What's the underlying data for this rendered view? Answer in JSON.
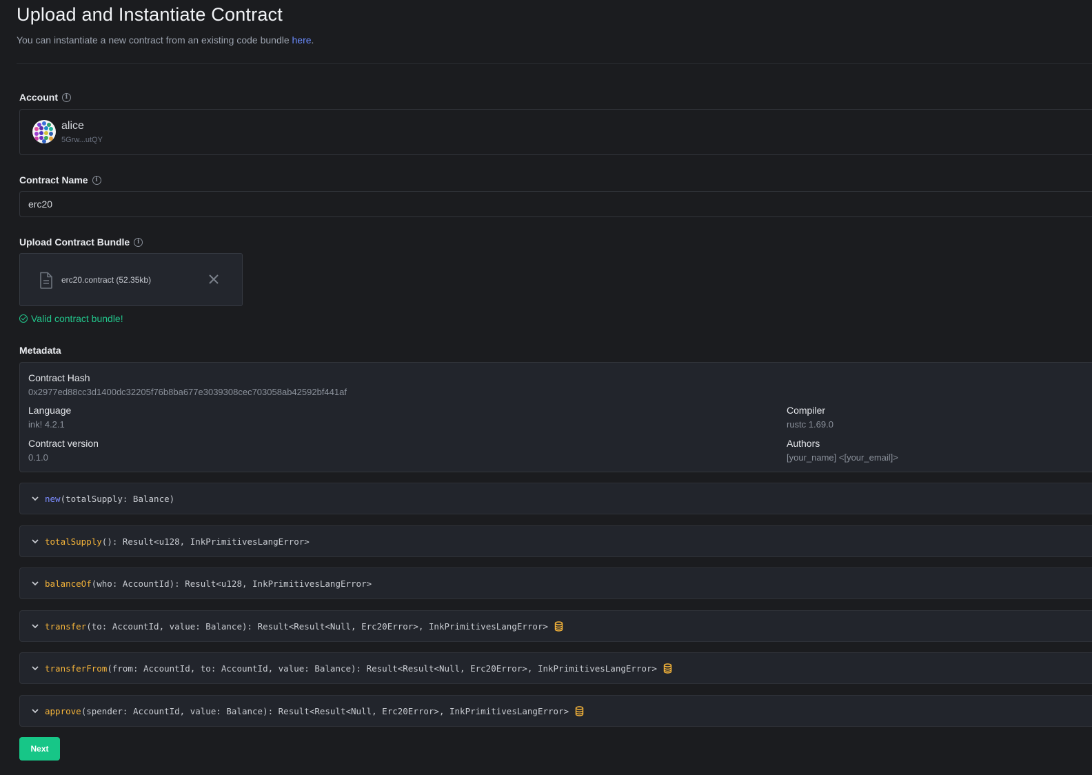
{
  "header": {
    "title": "Upload and Instantiate Contract",
    "subtitle_prefix": "You can instantiate a new contract from an existing code bundle ",
    "subtitle_link": "here",
    "subtitle_suffix": "."
  },
  "account": {
    "label": "Account",
    "name": "alice",
    "address": "5Grw...utQY"
  },
  "contract_name": {
    "label": "Contract Name",
    "value": "erc20"
  },
  "upload": {
    "label": "Upload Contract Bundle",
    "file_name": "erc20.contract (52.35kb)",
    "valid_message": "Valid contract bundle!"
  },
  "metadata": {
    "label": "Metadata",
    "contract_hash_key": "Contract Hash",
    "contract_hash": "0x2977ed88cc3d1400dc32205f76b8ba677e3039308cec703058ab42592bf441af",
    "language_key": "Language",
    "language": "ink! 4.2.1",
    "compiler_key": "Compiler",
    "compiler": "rustc 1.69.0",
    "version_key": "Contract version",
    "version": "0.1.0",
    "authors_key": "Authors",
    "authors": "[your_name] <[your_email]>"
  },
  "messages": [
    {
      "name": "new",
      "kind": "constructor",
      "rest": "(totalSupply: Balance)",
      "mutates": false
    },
    {
      "name": "totalSupply",
      "kind": "message",
      "rest": "(): Result<u128, InkPrimitivesLangError>",
      "mutates": false
    },
    {
      "name": "balanceOf",
      "kind": "message",
      "rest": "(who: AccountId): Result<u128, InkPrimitivesLangError>",
      "mutates": false
    },
    {
      "name": "transfer",
      "kind": "message",
      "rest": "(to: AccountId, value: Balance): Result<Result<Null, Erc20Error>, InkPrimitivesLangError>",
      "mutates": true
    },
    {
      "name": "transferFrom",
      "kind": "message",
      "rest": "(from: AccountId, to: AccountId, value: Balance): Result<Result<Null, Erc20Error>, InkPrimitivesLangError>",
      "mutates": true
    },
    {
      "name": "approve",
      "kind": "message",
      "rest": "(spender: AccountId, value: Balance): Result<Result<Null, Erc20Error>, InkPrimitivesLangError>",
      "mutates": true
    }
  ],
  "footer": {
    "next_label": "Next"
  },
  "colors": {
    "accent_green": "#17c687",
    "link_blue": "#6b8cff",
    "message_orange": "#f5b43a",
    "constructor_blue": "#7c8cff"
  },
  "icons": [
    "info-icon",
    "file-icon",
    "close-icon",
    "check-circle-icon",
    "chevron-down-icon",
    "database-icon"
  ]
}
